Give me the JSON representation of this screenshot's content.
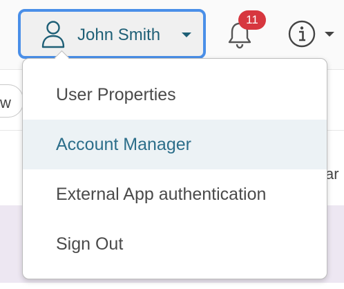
{
  "header": {
    "user_name": "John Smith",
    "notification_count": "11",
    "user_icon": "user-icon",
    "bell_icon": "bell-icon",
    "info_icon": "info-icon"
  },
  "background": {
    "left_fragment": "w",
    "right_fragment": "ar"
  },
  "menu": {
    "items": [
      {
        "label": "User Properties"
      },
      {
        "label": "Account Manager"
      },
      {
        "label": "External App authentication"
      },
      {
        "label": "Sign Out"
      }
    ]
  },
  "colors": {
    "accent": "#4a8fe8",
    "user_text": "#1e5f76",
    "badge": "#d7373f",
    "hover_bg": "#ecf2f5"
  }
}
